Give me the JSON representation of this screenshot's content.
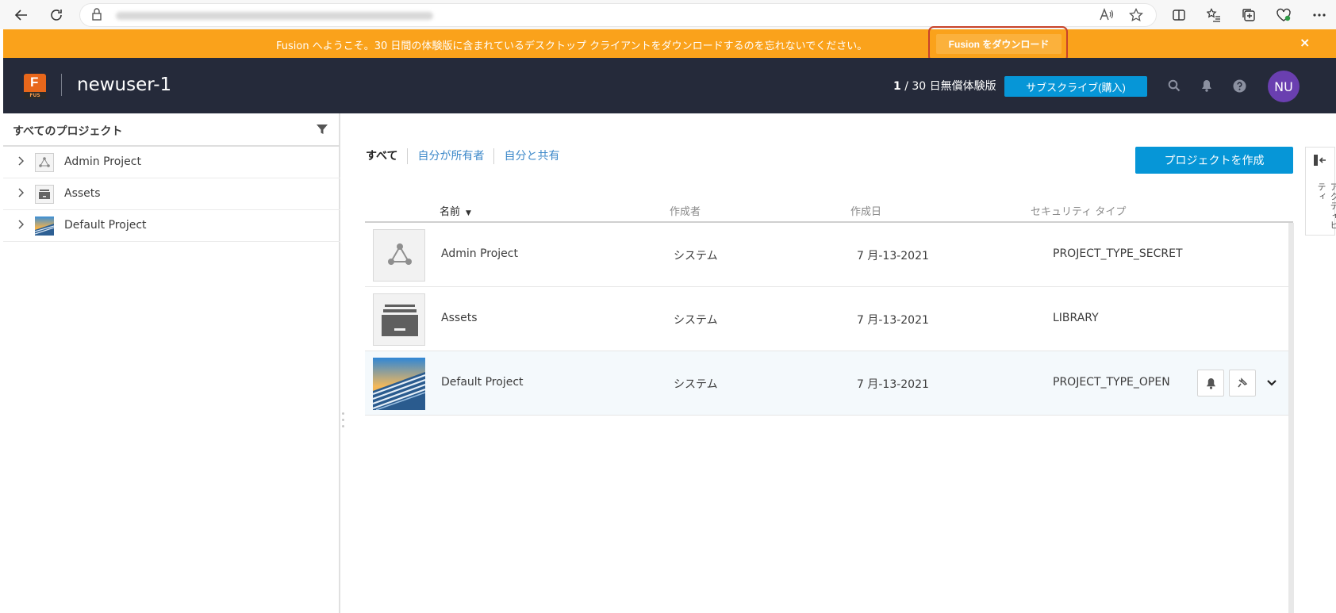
{
  "banner": {
    "message": "Fusion へようこそ。30 日間の体験版に含まれているデスクトップ クライアントをダウンロードするのを忘れないでください。",
    "download_label": "Fusion をダウンロード",
    "close_label": "×"
  },
  "header": {
    "logo_letter": "F",
    "logo_sub": "FUS",
    "hub_name": "newuser-1",
    "trial_current": "1",
    "trial_text": " / 30 日無償体験版",
    "subscribe_label": "サブスクライブ(購入)",
    "avatar_initials": "NU"
  },
  "sidebar": {
    "title": "すべてのプロジェクト",
    "items": [
      {
        "label": "Admin Project",
        "icon": "hub-triangle-icon"
      },
      {
        "label": "Assets",
        "icon": "archive-box-icon"
      },
      {
        "label": "Default Project",
        "icon": "project-thumbnail"
      }
    ]
  },
  "main": {
    "tabs": [
      {
        "label": "すべて",
        "active": true
      },
      {
        "label": "自分が所有者",
        "active": false
      },
      {
        "label": "自分と共有",
        "active": false
      }
    ],
    "create_label": "プロジェクトを作成",
    "columns": {
      "name": "名前",
      "creator": "作成者",
      "created": "作成日",
      "security": "セキュリティ タイプ"
    },
    "sort_indicator": "▼",
    "rows": [
      {
        "name": "Admin Project",
        "creator": "システム",
        "created": "7 月-13-2021",
        "security": "PROJECT_TYPE_SECRET"
      },
      {
        "name": "Assets",
        "creator": "システム",
        "created": "7 月-13-2021",
        "security": "LIBRARY"
      },
      {
        "name": "Default Project",
        "creator": "システム",
        "created": "7 月-13-2021",
        "security": "PROJECT_TYPE_OPEN"
      }
    ]
  },
  "activity_panel": {
    "label": "アクティビティ"
  },
  "colors": {
    "banner": "#faa21b",
    "header": "#252a3a",
    "accent_blue": "#0696d7",
    "avatar": "#6a3fb0",
    "logo": "#e8671b"
  }
}
